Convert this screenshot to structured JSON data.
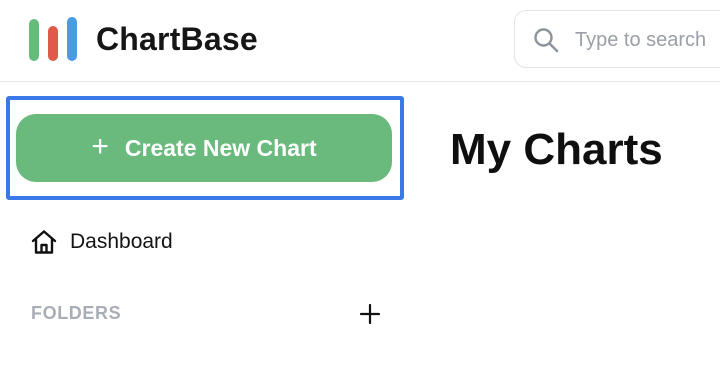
{
  "app": {
    "name": "ChartBase",
    "logo_colors": [
      "#67bb7a",
      "#de5b4b",
      "#4b9be3"
    ]
  },
  "header": {
    "search": {
      "placeholder": "Type to search",
      "value": "",
      "icon": "search-icon"
    }
  },
  "sidebar": {
    "create_button": {
      "label": "Create New Chart",
      "icon": "plus-icon",
      "color": "#6aba7e"
    },
    "highlight_color": "#3b78e7",
    "nav": [
      {
        "label": "Dashboard",
        "icon": "home-icon"
      }
    ],
    "folders": {
      "label": "FOLDERS",
      "add_icon": "plus-icon"
    }
  },
  "main": {
    "title": "My Charts"
  }
}
